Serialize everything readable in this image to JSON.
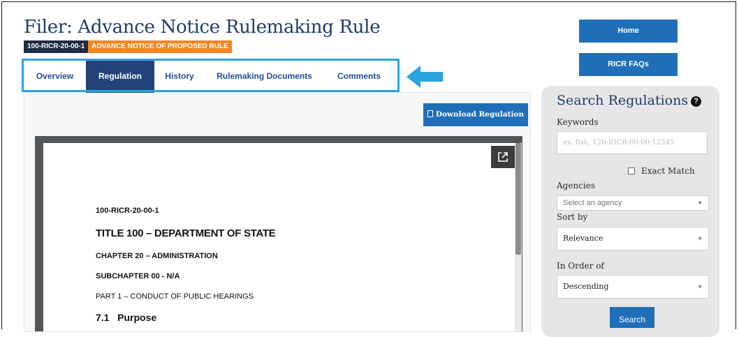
{
  "page": {
    "title": "Filer: Advance Notice Rulemaking Rule",
    "badge_id": "100-RICR-20-00-1",
    "badge_type": "ADVANCE NOTICE OF PROPOSED RULE"
  },
  "tabs": [
    {
      "label": "Overview",
      "active": false
    },
    {
      "label": "Regulation",
      "active": true
    },
    {
      "label": "History",
      "active": false
    },
    {
      "label": "Rulemaking Documents",
      "active": false
    },
    {
      "label": "Comments",
      "active": false
    }
  ],
  "download_label": "Download Regulation",
  "document": {
    "line1": "100-RICR-20-00-1",
    "title": "TITLE 100 – DEPARTMENT OF STATE",
    "chapter": "CHAPTER 20 – ADMINISTRATION",
    "subchapter": "SUBCHAPTER 00 - N/A",
    "part": "PART 1 – CONDUCT OF PUBLIC HEARINGS",
    "section_number": "7.1",
    "section_title": "Purpose"
  },
  "sidebar": {
    "home_label": "Home",
    "faqs_label": "RICR FAQs",
    "search": {
      "title": "Search Regulations",
      "keywords_label": "Keywords",
      "keywords_placeholder": "ex. fish, 120-RICR-00-00-12345",
      "exact_match_label": "Exact Match",
      "agencies_label": "Agencies",
      "agencies_placeholder": "Select an agency",
      "sort_label": "Sort by",
      "sort_value": "Relevance",
      "order_label": "In Order of",
      "order_value": "Descending",
      "submit_label": "Search"
    }
  },
  "colors": {
    "brand_navy": "#1f3d6a",
    "button_blue": "#1f6fb8",
    "active_tab": "#22437a",
    "badge_orange": "#f5861f",
    "highlight_cyan": "#2aa4dc"
  }
}
